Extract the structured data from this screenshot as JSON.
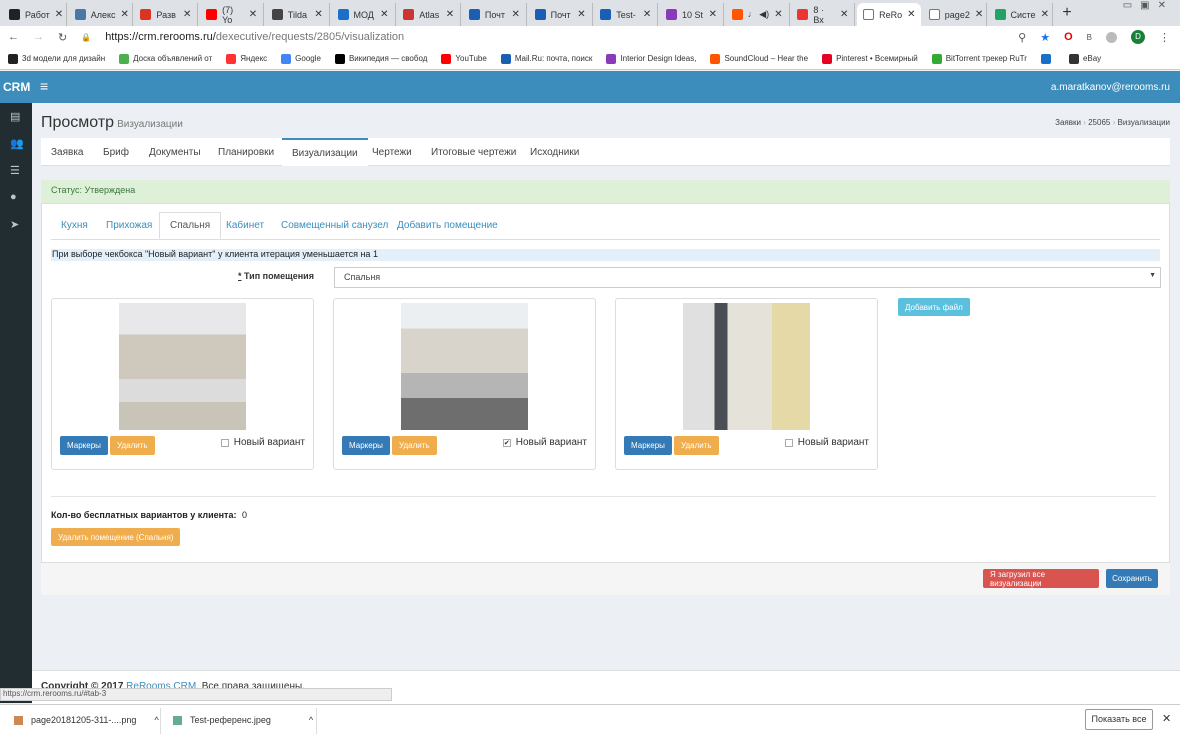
{
  "browser": {
    "tabs": [
      {
        "label": "Работ",
        "color": "#222"
      },
      {
        "label": "Алекс",
        "color": "#4a76a8"
      },
      {
        "label": "Разв",
        "color": "#d32"
      },
      {
        "label": "(7) Yo",
        "color": "#f00"
      },
      {
        "label": "Tilda",
        "color": "#444"
      },
      {
        "label": "МОД",
        "color": "#1a6fc9"
      },
      {
        "label": "Atlas",
        "color": "#c33"
      },
      {
        "label": "Почт",
        "color": "#1a5fb4"
      },
      {
        "label": "Почт",
        "color": "#1a5fb4"
      },
      {
        "label": "Test-",
        "color": "#1a5fb4"
      },
      {
        "label": "10 St",
        "color": "#8a3ab9"
      },
      {
        "label": "♩ ◀)",
        "color": "#f50"
      },
      {
        "label": "8 · Вх",
        "color": "#e33"
      },
      {
        "label": "ReRo",
        "color": "#fff",
        "active": true
      },
      {
        "label": "page2",
        "color": "#fff"
      },
      {
        "label": "Систе",
        "color": "#1fa463"
      }
    ],
    "url_host": "https://crm.rerooms.ru/",
    "url_path": "dexecutive/requests/2805/visualization",
    "profile_initial": "D",
    "ext_label": "B",
    "bookmarks": [
      {
        "label": "3d модели для дизайн",
        "color": "#222"
      },
      {
        "label": "Доска объявлений от",
        "color": "#4caf50"
      },
      {
        "label": "Яндекс",
        "color": "#f33"
      },
      {
        "label": "Google",
        "color": "#4285f4"
      },
      {
        "label": "Википедия — свобод",
        "color": "#000"
      },
      {
        "label": "YouTube",
        "color": "#f00"
      },
      {
        "label": "Mail.Ru: почта, поиск",
        "color": "#1a5fb4"
      },
      {
        "label": "Interior Design Ideas,",
        "color": "#8a3ab9"
      },
      {
        "label": "SoundCloud – Hear the",
        "color": "#f50"
      },
      {
        "label": "Pinterest • Всемирный",
        "color": "#e60023"
      },
      {
        "label": "BitTorrent трекер RuTr",
        "color": "#3a3"
      },
      {
        "label": "",
        "color": "#1a6fc9"
      },
      {
        "label": "eBay",
        "color": "#333"
      }
    ]
  },
  "app": {
    "logo": "CRM",
    "user": "a.maratkanov@rerooms.ru",
    "menu_icon": "≡"
  },
  "page": {
    "title": "Просмотр",
    "subtitle": "Визуализации",
    "breadcrumb": [
      "Заявки",
      "25065",
      "Визуализации"
    ]
  },
  "tabs": [
    "Заявка",
    "Бриф",
    "Документы",
    "Планировки",
    "Визуализации",
    "Чертежи",
    "Итоговые чертежи",
    "Исходники"
  ],
  "active_tab": "Визуализации",
  "status": "Статус: Утверждена",
  "rooms": [
    "Кухня",
    "Прихожая",
    "Спальня",
    "Кабинет",
    "Совмещенный санузел",
    "Добавить помещение"
  ],
  "active_room": "Спальня",
  "info": "При выборе чекбокса \"Новый вариант\" у клиента итерация уменьшается на 1",
  "room_type": {
    "required": "*",
    "label": "Тип помещения",
    "value": "Спальня"
  },
  "add_file": "Добавить файл",
  "cards": [
    {
      "markers": "Маркеры",
      "delete": "Удалить",
      "new_variant": "Новый вариант",
      "checked": false
    },
    {
      "markers": "Маркеры",
      "delete": "Удалить",
      "new_variant": "Новый вариант",
      "checked": true
    },
    {
      "markers": "Маркеры",
      "delete": "Удалить",
      "new_variant": "Новый вариант",
      "checked": false
    }
  ],
  "free_variants": {
    "label": "Кол-во бесплатных вариантов у клиента:",
    "value": "0"
  },
  "delete_room": "Удалить помещение (Спальня)",
  "uploaded_all": "Я загрузил все визуализации",
  "save": "Сохранить",
  "footer": {
    "copyright": "Copyright © 2017",
    "brand": "ReRooms CRM.",
    "rights": "Все права защищены."
  },
  "status_url": "https://crm.rerooms.ru/#tab-3",
  "downloads": [
    {
      "name": "page20181205-311-....png"
    },
    {
      "name": "Test-референс.jpeg"
    }
  ],
  "show_all": "Показать все"
}
